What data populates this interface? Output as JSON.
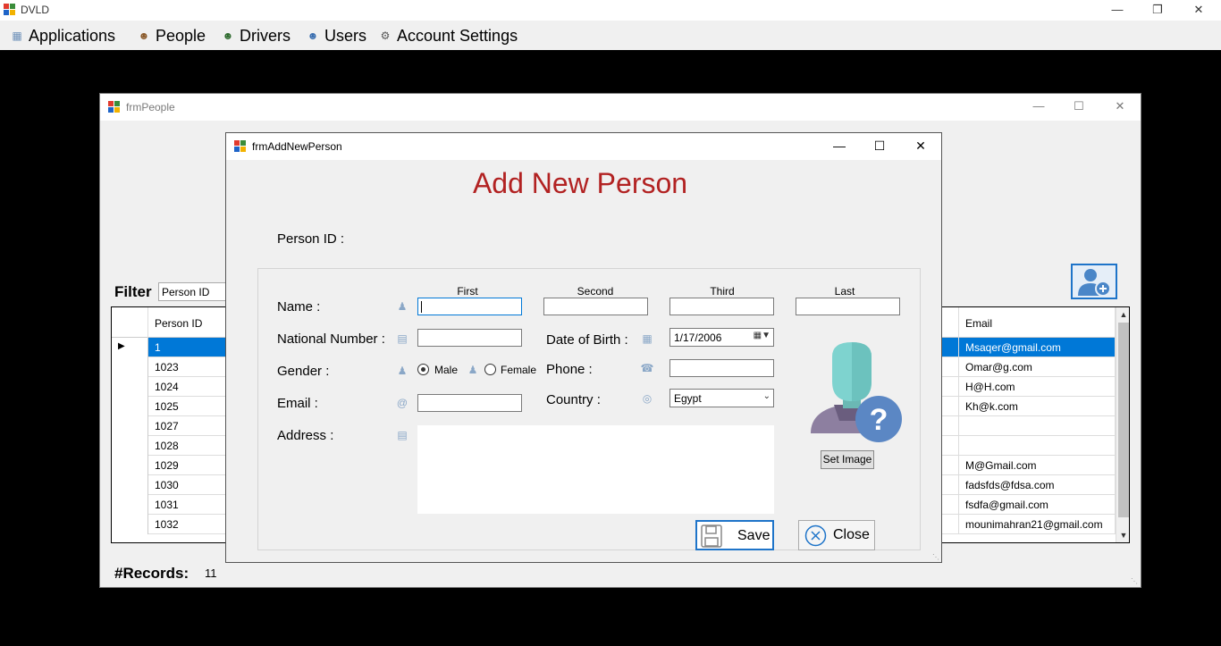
{
  "main_window": {
    "title": "DVLD",
    "menu": [
      {
        "label": "Applications",
        "icon": "applications-icon"
      },
      {
        "label": "People",
        "icon": "people-icon"
      },
      {
        "label": "Drivers",
        "icon": "drivers-icon"
      },
      {
        "label": "Users",
        "icon": "users-icon"
      },
      {
        "label": "Account Settings",
        "icon": "account-settings-icon"
      }
    ]
  },
  "people_window": {
    "title": "frmPeople",
    "filter_label": "Filter",
    "filter_value": "Person ID",
    "grid": {
      "columns": [
        "Person ID",
        "Email"
      ],
      "rows": [
        {
          "id": "1",
          "email": "Msaqer@gmail.com",
          "selected": true
        },
        {
          "id": "1023",
          "email": "Omar@g.com"
        },
        {
          "id": "1024",
          "email": "H@H.com"
        },
        {
          "id": "1025",
          "email": "Kh@k.com"
        },
        {
          "id": "1027",
          "email": ""
        },
        {
          "id": "1028",
          "email": ""
        },
        {
          "id": "1029",
          "email": "M@Gmail.com"
        },
        {
          "id": "1030",
          "email": "fadsfds@fdsa.com"
        },
        {
          "id": "1031",
          "email": "fsdfa@gmail.com"
        },
        {
          "id": "1032",
          "email": "mounimahran21@gmail.com"
        }
      ]
    },
    "records_label": "#Records:",
    "records_value": "11"
  },
  "add_person_dialog": {
    "title": "frmAddNewPerson",
    "heading": "Add New Person",
    "person_id_label": "Person ID :",
    "name_columns": [
      "First",
      "Second",
      "Third",
      "Last"
    ],
    "labels": {
      "name": "Name :",
      "national_number": "National Number :",
      "gender": "Gender :",
      "email": "Email :",
      "address": "Address :",
      "dob": "Date of Birth :",
      "phone": "Phone :",
      "country": "Country :"
    },
    "gender_options": {
      "male": "Male",
      "female": "Female",
      "selected": "male"
    },
    "date_of_birth": "1/17/2006",
    "country": "Egypt",
    "set_image_label": "Set Image",
    "save_label": "Save",
    "close_label": "Close"
  },
  "colors": {
    "heading": "#b22222",
    "selection": "#0078d7",
    "accent_border": "#1e74c9"
  }
}
